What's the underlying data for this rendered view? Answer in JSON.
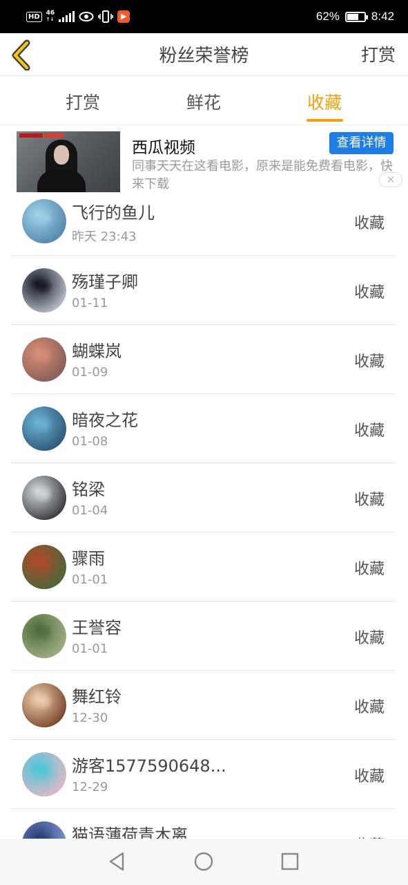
{
  "status_bar": {
    "hd": "HD",
    "network": "46",
    "battery_percent": "62%",
    "battery_level": 0.62,
    "time": "8:42"
  },
  "header": {
    "title": "粉丝荣誉榜",
    "action": "打赏",
    "back_icon": "chevron-left-icon"
  },
  "tabs": [
    {
      "label": "打赏",
      "active": false
    },
    {
      "label": "鲜花",
      "active": false
    },
    {
      "label": "收藏",
      "active": true
    }
  ],
  "colors": {
    "accent": "#f2a20e",
    "ad_button": "#1f7de6"
  },
  "ad": {
    "title": "西瓜视频",
    "description": "同事天天在这看电影，原来是能免费看电影，快来下载",
    "button": "查看详情",
    "close": "✕"
  },
  "list": [
    {
      "name": "飞行的鱼儿",
      "time": "昨天 23:43",
      "action": "收藏",
      "avatar_colors": [
        "#9fd3e8",
        "#4d7fa6"
      ]
    },
    {
      "name": "殇瑾子卿",
      "time": "01-11",
      "action": "收藏",
      "avatar_colors": [
        "#0e1420",
        "#c8d0dc"
      ]
    },
    {
      "name": "蝴蝶岚",
      "time": "01-09",
      "action": "收藏",
      "avatar_colors": [
        "#d98e76",
        "#7d5a55"
      ]
    },
    {
      "name": "暗夜之花",
      "time": "01-08",
      "action": "收藏",
      "avatar_colors": [
        "#6bb3d6",
        "#2b4f6e"
      ]
    },
    {
      "name": "铭梁",
      "time": "01-04",
      "action": "收藏",
      "avatar_colors": [
        "#d7d9dc",
        "#2a2a2e"
      ]
    },
    {
      "name": "骤雨",
      "time": "01-01",
      "action": "收藏",
      "avatar_colors": [
        "#b34a2a",
        "#3f6a3a"
      ]
    },
    {
      "name": "王誉容",
      "time": "01-01",
      "action": "收藏",
      "avatar_colors": [
        "#4f6b3a",
        "#a8b58a"
      ]
    },
    {
      "name": "舞红铃",
      "time": "12-30",
      "action": "收藏",
      "avatar_colors": [
        "#f1cfb0",
        "#6e3a1e"
      ]
    },
    {
      "name": "游客1577590648...",
      "time": "12-29",
      "action": "收藏",
      "avatar_colors": [
        "#49c7d8",
        "#f0b6c6"
      ]
    },
    {
      "name": "猫语薄荷青木离",
      "time": "",
      "action": "收藏",
      "avatar_colors": [
        "#2b3f7a",
        "#8aa0d8"
      ]
    }
  ],
  "nav": {
    "back_icon": "triangle-back-icon",
    "home_icon": "circle-home-icon",
    "recents_icon": "square-recents-icon"
  }
}
